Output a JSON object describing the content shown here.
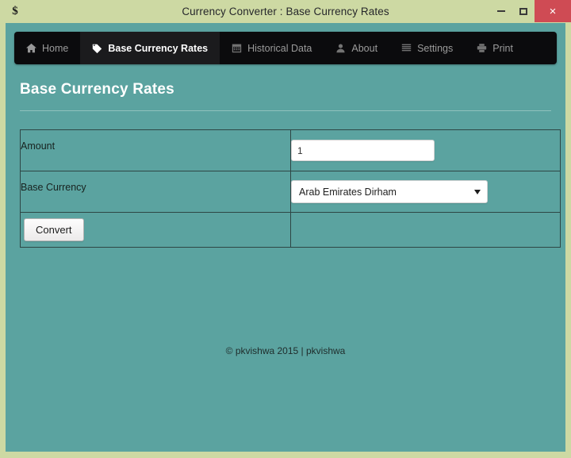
{
  "window": {
    "app_icon": "dollar-sign-icon",
    "title": "Currency Converter : Base Currency Rates",
    "minimize_label": "–",
    "maximize_label": "☐",
    "close_label": "×"
  },
  "nav": {
    "items": [
      {
        "label": "Home",
        "icon": "home-icon",
        "active": false
      },
      {
        "label": "Base Currency Rates",
        "icon": "tag-icon",
        "active": true
      },
      {
        "label": "Historical Data",
        "icon": "calendar-icon",
        "active": false
      },
      {
        "label": "About",
        "icon": "user-icon",
        "active": false
      },
      {
        "label": "Settings",
        "icon": "list-icon",
        "active": false
      },
      {
        "label": "Print",
        "icon": "printer-icon",
        "active": false
      }
    ]
  },
  "page": {
    "title": "Base Currency Rates"
  },
  "form": {
    "rows": [
      {
        "label": "Amount"
      },
      {
        "label": "Base Currency"
      }
    ],
    "amount": {
      "value": "1",
      "placeholder": ""
    },
    "base_currency": {
      "selected": "Arab Emirates Dirham"
    },
    "convert_label": "Convert"
  },
  "footer": {
    "text": "© pkvishwa 2015 | pkvishwa"
  },
  "colors": {
    "window_frame": "#cdd9a3",
    "client_background": "#5ba3a0",
    "navbar": "#0b0b0d",
    "nav_active": "#1b1b1d",
    "close_button": "#cf4b54",
    "table_border": "#2e4645"
  }
}
